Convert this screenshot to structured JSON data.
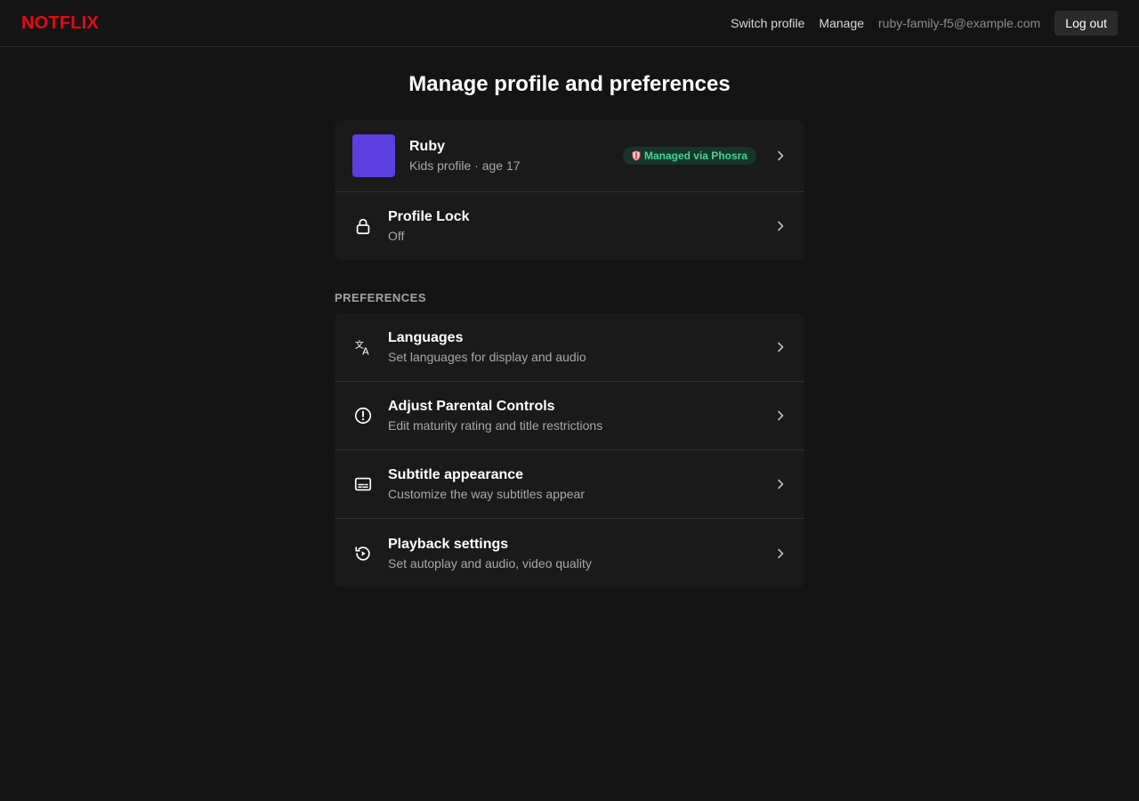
{
  "header": {
    "logo": "NOTFLIX",
    "switch_profile": "Switch profile",
    "manage": "Manage",
    "email": "ruby-family-f5@example.com",
    "logout": "Log out"
  },
  "page": {
    "title": "Manage profile and preferences"
  },
  "profile": {
    "name": "Ruby",
    "subtitle": "Kids profile · age 17",
    "avatar_color": "#5b3fe0",
    "badge": "Managed via Phosra",
    "badge_icon": "shield-icon"
  },
  "profile_lock": {
    "title": "Profile Lock",
    "status": "Off",
    "icon": "lock-icon"
  },
  "preferences": {
    "label": "PREFERENCES",
    "items": [
      {
        "title": "Languages",
        "subtitle": "Set languages for display and audio",
        "icon": "translate-icon"
      },
      {
        "title": "Adjust Parental Controls",
        "subtitle": "Edit maturity rating and title restrictions",
        "icon": "alert-circle-icon"
      },
      {
        "title": "Subtitle appearance",
        "subtitle": "Customize the way subtitles appear",
        "icon": "subtitles-icon"
      },
      {
        "title": "Playback settings",
        "subtitle": "Set autoplay and audio, video quality",
        "icon": "playback-icon"
      }
    ]
  },
  "colors": {
    "brand": "#e50914",
    "background": "#141414",
    "card": "#1a1a1a",
    "badge_bg": "#17352a",
    "badge_text": "#46d39a"
  }
}
